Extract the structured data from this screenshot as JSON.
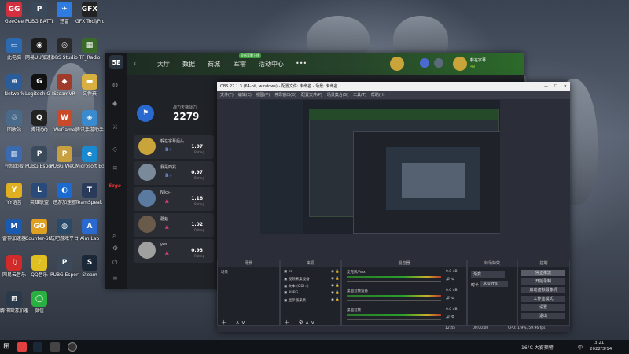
{
  "desktop": {
    "icons": [
      {
        "label": "GeeGee",
        "color": "#d32f3f",
        "glyph": "GG"
      },
      {
        "label": "PUBG BATTLEGR...",
        "color": "#3b4a5a",
        "glyph": "P"
      },
      {
        "label": "迅雷",
        "color": "#2f7be0",
        "glyph": "✈"
      },
      {
        "label": "GFX Tool/Pro...",
        "color": "#222222",
        "glyph": "GFX"
      },
      {
        "label": "此电脑",
        "color": "#2b6ab0",
        "glyph": "▭"
      },
      {
        "label": "网易UU加速器",
        "color": "#1c1c1c",
        "glyph": "◉"
      },
      {
        "label": "OBS Studio",
        "color": "#2a2a2a",
        "glyph": "◎"
      },
      {
        "label": "TF_Radio",
        "color": "#3a6a2a",
        "glyph": "▦"
      },
      {
        "label": "Network",
        "color": "#2b5d9a",
        "glyph": "⊕"
      },
      {
        "label": "Logitech G HUB",
        "color": "#111111",
        "glyph": "G"
      },
      {
        "label": "SteamVR",
        "color": "#a03a2a",
        "glyph": "◆"
      },
      {
        "label": "文件夹",
        "color": "#d8b040",
        "glyph": "▬"
      },
      {
        "label": "回收站",
        "color": "#4a6a8a",
        "glyph": "♲"
      },
      {
        "label": "腾讯QQ",
        "color": "#222222",
        "glyph": "Q"
      },
      {
        "label": "WeGame",
        "color": "#c84a2a",
        "glyph": "W"
      },
      {
        "label": "腾讯手游助手",
        "color": "#3a8ad0",
        "glyph": "◈"
      },
      {
        "label": "控制面板",
        "color": "#3a6ab0",
        "glyph": "▤"
      },
      {
        "label": "PUBG Esport...",
        "color": "#3a4a5a",
        "glyph": "P"
      },
      {
        "label": "PUBG WeChat",
        "color": "#c8a040",
        "glyph": "P"
      },
      {
        "label": "Microsoft Edge",
        "color": "#1a8ad0",
        "glyph": "e"
      },
      {
        "label": "YY语音",
        "color": "#e0b020",
        "glyph": "Y"
      },
      {
        "label": "英雄联盟",
        "color": "#2a4a7a",
        "glyph": "L"
      },
      {
        "label": "迅游加速器",
        "color": "#1a6ad0",
        "glyph": "◐"
      },
      {
        "label": "TeamSpeak 3",
        "color": "#2a3a5a",
        "glyph": "T"
      },
      {
        "label": "雷神加速器",
        "color": "#1a5ab0",
        "glyph": "M"
      },
      {
        "label": "Counter-Strike Global Off...",
        "color": "#e0a020",
        "glyph": "GO"
      },
      {
        "label": "玩吧游戏平台",
        "color": "#2a4a6a",
        "glyph": "◍"
      },
      {
        "label": "Aim Lab",
        "color": "#2a6ad0",
        "glyph": "A"
      },
      {
        "label": "网易云音乐",
        "color": "#d02a2a",
        "glyph": "♫"
      },
      {
        "label": "QQ音乐",
        "color": "#e0c020",
        "glyph": "♪"
      },
      {
        "label": "PUBG Esport...",
        "color": "#3a4a5a",
        "glyph": "P"
      },
      {
        "label": "Steam",
        "color": "#1b2838",
        "glyph": "S"
      },
      {
        "label": "腾讯网游加速器",
        "color": "#2a3a4a",
        "glyph": "⊞"
      },
      {
        "label": "微信",
        "color": "#2ab040",
        "glyph": "◯"
      }
    ]
  },
  "client5e": {
    "logo": "5E",
    "nav": [
      "大厅",
      "数据",
      "商城",
      "军需",
      "活动中心",
      "•••"
    ],
    "nav_badge": "全新军需上线",
    "username": "躲在字幕...",
    "user_level": "4V",
    "team_label": "战力天梯战力",
    "team_score": "2279",
    "side_logo": "Ezgo",
    "players": [
      {
        "name": "躲在字幕后头",
        "rank": "B+",
        "score": "1.07",
        "label": "Rating",
        "color": "#c9a43a"
      },
      {
        "name": "我是四兆",
        "rank": "B+",
        "score": "0.97",
        "label": "Rating",
        "color": "#7a8a9a"
      },
      {
        "name": "Niko-",
        "rank": "A",
        "score": "1.18",
        "label": "Rating",
        "color": "#5a7aa0"
      },
      {
        "name": "蘑菇",
        "rank": "A",
        "score": "1.02",
        "label": "Rating",
        "color": "#6a5a4a"
      },
      {
        "name": "yes",
        "rank": "A",
        "score": "0.93",
        "label": "Rating",
        "color": "#a0a0a0"
      }
    ]
  },
  "obs": {
    "title": "OBS 27.1.3 (64-bit, windows) - 配置文件: 未命名 - 场景: 未命名",
    "menu": [
      "文件(F)",
      "编辑(E)",
      "视图(V)",
      "停靠窗口(D)",
      "配置文件(P)",
      "场景集合(S)",
      "工具(T)",
      "帮助(H)"
    ],
    "scene_bar": [
      "屏幕",
      "场景"
    ],
    "dock_titles": [
      "场景",
      "来源",
      "混音器",
      "转场特效",
      "控制"
    ],
    "scenes": [
      "场景"
    ],
    "sources": [
      "cs",
      "视频采集设备",
      "文本 (GDI+)",
      "PUBG",
      "显示器采集"
    ],
    "mixer": [
      {
        "name": "麦克风/Aux",
        "db": "0.0 dB"
      },
      {
        "name": "桌面音频设备",
        "db": "0.0 dB"
      },
      {
        "name": "桌面音频",
        "db": "0.0 dB"
      }
    ],
    "transition": {
      "type": "渐变",
      "duration_label": "时长",
      "duration": "300 ms"
    },
    "controls": [
      "停止推流",
      "开始录制",
      "启动虚拟摄像机",
      "工作室模式",
      "设置",
      "退出"
    ],
    "status": "LIVE: 00:00:00   REC: 00:00:00   CPU: 1.9%, 59.96 fps",
    "status_live": "12:45",
    "status_rec": "00:00:00",
    "status_cpu": "CPU: 1.9%, 59.96 fps"
  },
  "taskbar": {
    "weather": "16°C 大雾预警",
    "time": "3:21",
    "date": "2022/3/14",
    "lang": "中"
  }
}
